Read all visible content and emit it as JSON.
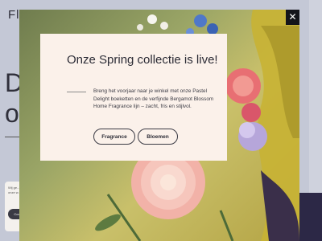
{
  "background": {
    "logo": "Fl",
    "heading": "D\no",
    "cookie": {
      "text": "Wij ge...\nonze w...",
      "button_label": "Coo"
    }
  },
  "modal": {
    "title": "Onze Spring collectie is live!",
    "body": "Breng het voorjaar naar je winkel met onze Pastel Delight boeketten en de verfijnde Bergamot Blossom Home Fragrance lijn – zacht, fris en stijlvol.",
    "buttons": {
      "fragrance": "Fragrance",
      "bloemen": "Bloemen"
    },
    "close_symbol": "✕"
  },
  "colors": {
    "modal_bg": "#fbf1ea",
    "text": "#2c2c36",
    "close_bg": "#14141a"
  },
  "icons": {
    "close": "close-icon"
  }
}
